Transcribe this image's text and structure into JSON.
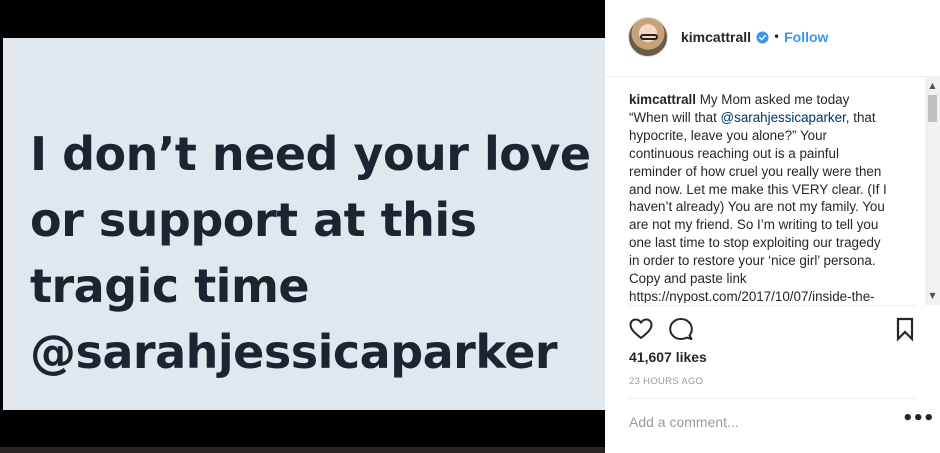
{
  "media": {
    "text_lines": [
      "I don’t need your love",
      "or support at this",
      "tragic time",
      "@sarahjessicaparker"
    ]
  },
  "header": {
    "avatar_icon": "profile-avatar",
    "username": "kimcattrall",
    "verified_icon": "verified-badge-icon",
    "separator": "•",
    "follow_label": "Follow"
  },
  "caption": {
    "username": "kimcattrall",
    "lines": [
      {
        "pre": "My Mom asked me today",
        "mention": "",
        "post": ""
      },
      {
        "pre": "“When will that ",
        "mention": "@sarahjessicaparker",
        "post": ", that"
      },
      {
        "pre": "hypocrite, leave you alone?” Your",
        "mention": "",
        "post": ""
      },
      {
        "pre": "continuous reaching out is a painful",
        "mention": "",
        "post": ""
      },
      {
        "pre": "reminder of how cruel you really were then",
        "mention": "",
        "post": ""
      },
      {
        "pre": "and now. Let me make this VERY clear. (If I",
        "mention": "",
        "post": ""
      },
      {
        "pre": "haven’t already) You are not my family. You",
        "mention": "",
        "post": ""
      },
      {
        "pre": "are not my friend. So I’m writing to tell you",
        "mention": "",
        "post": ""
      },
      {
        "pre": "one last time to stop exploiting our tragedy",
        "mention": "",
        "post": ""
      },
      {
        "pre": "in order to restore your ‘nice girl’ persona.",
        "mention": "",
        "post": ""
      },
      {
        "pre": "Copy and paste link",
        "mention": "",
        "post": ""
      },
      {
        "pre": "https://nypost.com/2017/10/07/inside-the-",
        "mention": "",
        "post": ""
      }
    ]
  },
  "scrollbar": {
    "up_arrow": "▲",
    "down_arrow": "▼"
  },
  "actions": {
    "like_icon": "heart-icon",
    "comment_icon": "comment-icon",
    "save_icon": "bookmark-icon"
  },
  "likes_text": "41,607 likes",
  "timestamp": "23 HOURS AGO",
  "comment": {
    "placeholder": "Add a comment...",
    "more_label": "•••"
  },
  "colors": {
    "link_blue": "#3897f0",
    "mention_blue": "#003569",
    "image_bg": "#e0e8ee",
    "image_text": "#1c2432"
  }
}
